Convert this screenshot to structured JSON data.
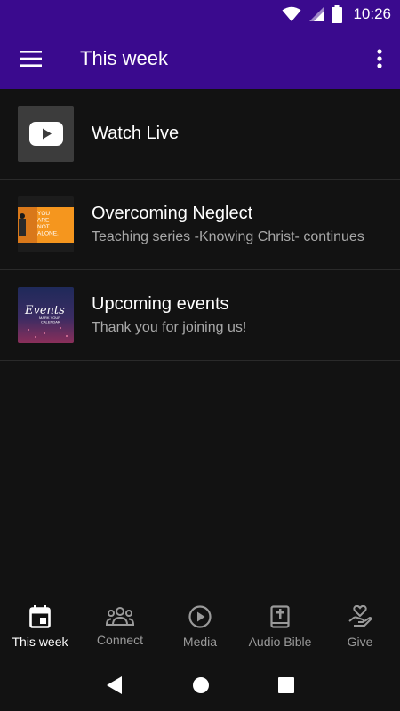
{
  "status_bar": {
    "time": "10:26"
  },
  "app_bar": {
    "title": "This week",
    "menu_icon": "hamburger-icon",
    "more_icon": "more-vert-icon"
  },
  "colors": {
    "primary": "#3a0a8e",
    "background": "#121212",
    "text": "#ffffff",
    "secondary_text": "#a8a8a8",
    "orange": "#f5961e"
  },
  "items": [
    {
      "title": "Watch Live",
      "subtitle": "",
      "thumb": "youtube-icon"
    },
    {
      "title": "Overcoming Neglect",
      "subtitle": "Teaching series -Knowing Christ- continues",
      "thumb": "sermon-thumbnail",
      "thumb_text": [
        "YOU",
        "ARE",
        "NOT",
        "ALONE."
      ]
    },
    {
      "title": "Upcoming events",
      "subtitle": "Thank you for joining us!",
      "thumb": "events-thumbnail",
      "thumb_text": [
        "Events",
        "MARK YOUR",
        "CALENDAR"
      ]
    }
  ],
  "bottom_nav": [
    {
      "label": "This week",
      "icon": "calendar-icon",
      "active": true
    },
    {
      "label": "Connect",
      "icon": "groups-icon",
      "active": false
    },
    {
      "label": "Media",
      "icon": "play-circle-icon",
      "active": false
    },
    {
      "label": "Audio Bible",
      "icon": "bible-icon",
      "active": false
    },
    {
      "label": "Give",
      "icon": "hand-heart-icon",
      "active": false
    }
  ],
  "system_nav": [
    "back-icon",
    "home-icon",
    "recents-icon"
  ]
}
